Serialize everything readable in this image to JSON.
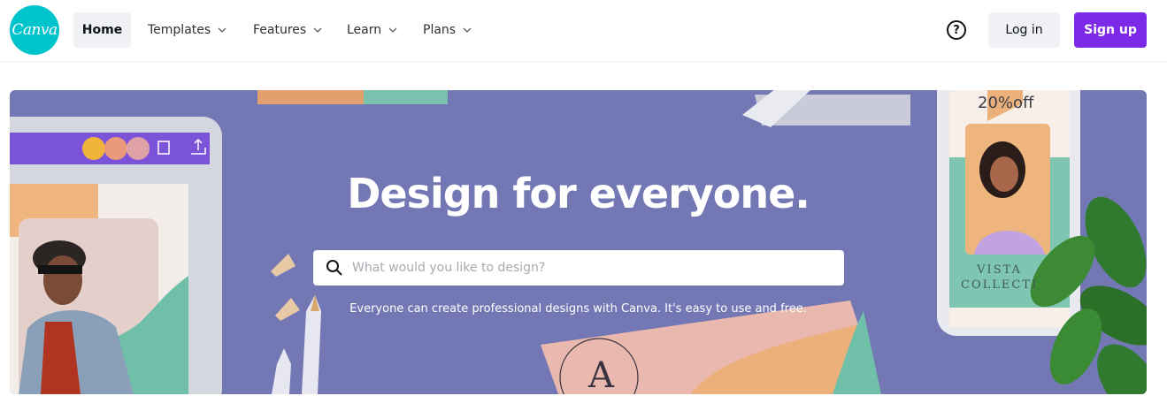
{
  "logo": {
    "text": "Canva",
    "color": "#00c4cc"
  },
  "nav": {
    "items": [
      {
        "label": "Home",
        "active": true
      },
      {
        "label": "Templates",
        "has_dropdown": true
      },
      {
        "label": "Features",
        "has_dropdown": true
      },
      {
        "label": "Learn",
        "has_dropdown": true
      },
      {
        "label": "Plans",
        "has_dropdown": true
      }
    ],
    "help_icon": "question-circle-icon",
    "help_glyph": "?",
    "login_label": "Log in",
    "signup_label": "Sign up",
    "accent_color": "#7d2ae8"
  },
  "hero": {
    "title": "Design for everyone.",
    "search": {
      "placeholder": "What would you like to design?",
      "value": "",
      "icon": "search-icon"
    },
    "tagline": "Everyone can create professional designs with Canva. It's easy to use and free.",
    "background_color": "#7378b5",
    "promo_text": "20%off",
    "vista_text": [
      "VISTA",
      "COLLECTI"
    ],
    "card_letter": "A"
  }
}
